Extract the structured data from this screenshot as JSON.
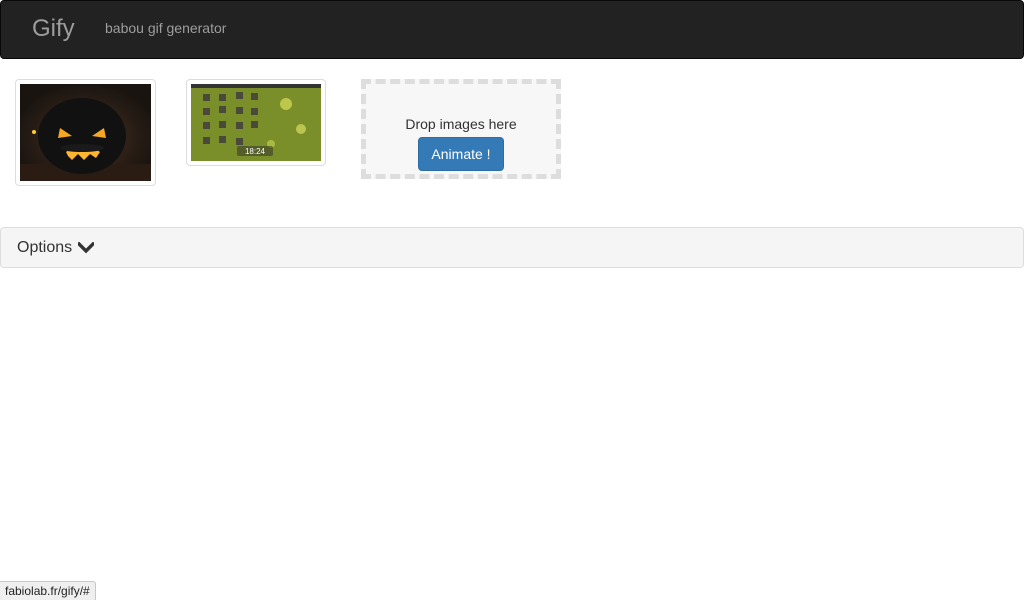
{
  "navbar": {
    "brand": "Gify",
    "tagline": "babou gif generator"
  },
  "thumbnails": [
    {
      "icon": "jack-o-lantern-image",
      "overlay_text": ""
    },
    {
      "icon": "desktop-screenshot-image",
      "overlay_text": "18:24"
    }
  ],
  "dropzone": {
    "text": "Drop images here",
    "button_label": "Animate !"
  },
  "options": {
    "label": "Options",
    "icon": "chevron-down-icon"
  },
  "statusbar": {
    "url": "fabiolab.fr/gify/#"
  },
  "colors": {
    "navbar_bg": "#222222",
    "navbar_text": "#9d9d9d",
    "primary_button": "#337ab7",
    "panel_bg": "#f5f5f5"
  }
}
